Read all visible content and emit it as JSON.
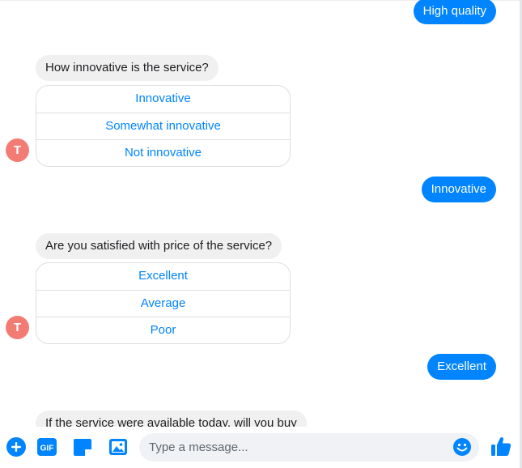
{
  "colors": {
    "accent": "#0084ff",
    "incoming_bubble": "#f1f0f0",
    "avatar": "#f27c73"
  },
  "conversation": {
    "outgoing_1": "High quality",
    "question_1": "How innovative is the service?",
    "options_1": [
      "Innovative",
      "Somewhat innovative",
      "Not innovative"
    ],
    "outgoing_2": "Innovative",
    "question_2": "Are you satisfied with price of the service?",
    "options_2": [
      "Excellent",
      "Average",
      "Poor"
    ],
    "outgoing_3": "Excellent",
    "question_3": "If the service were available today, will you buy"
  },
  "avatar": {
    "initial": "T"
  },
  "composer": {
    "placeholder": "Type a message...",
    "gif_label": "GIF",
    "icons": [
      "plus-icon",
      "gif-icon",
      "sticker-icon",
      "image-icon",
      "emoji-icon",
      "thumbs-up-icon"
    ]
  }
}
